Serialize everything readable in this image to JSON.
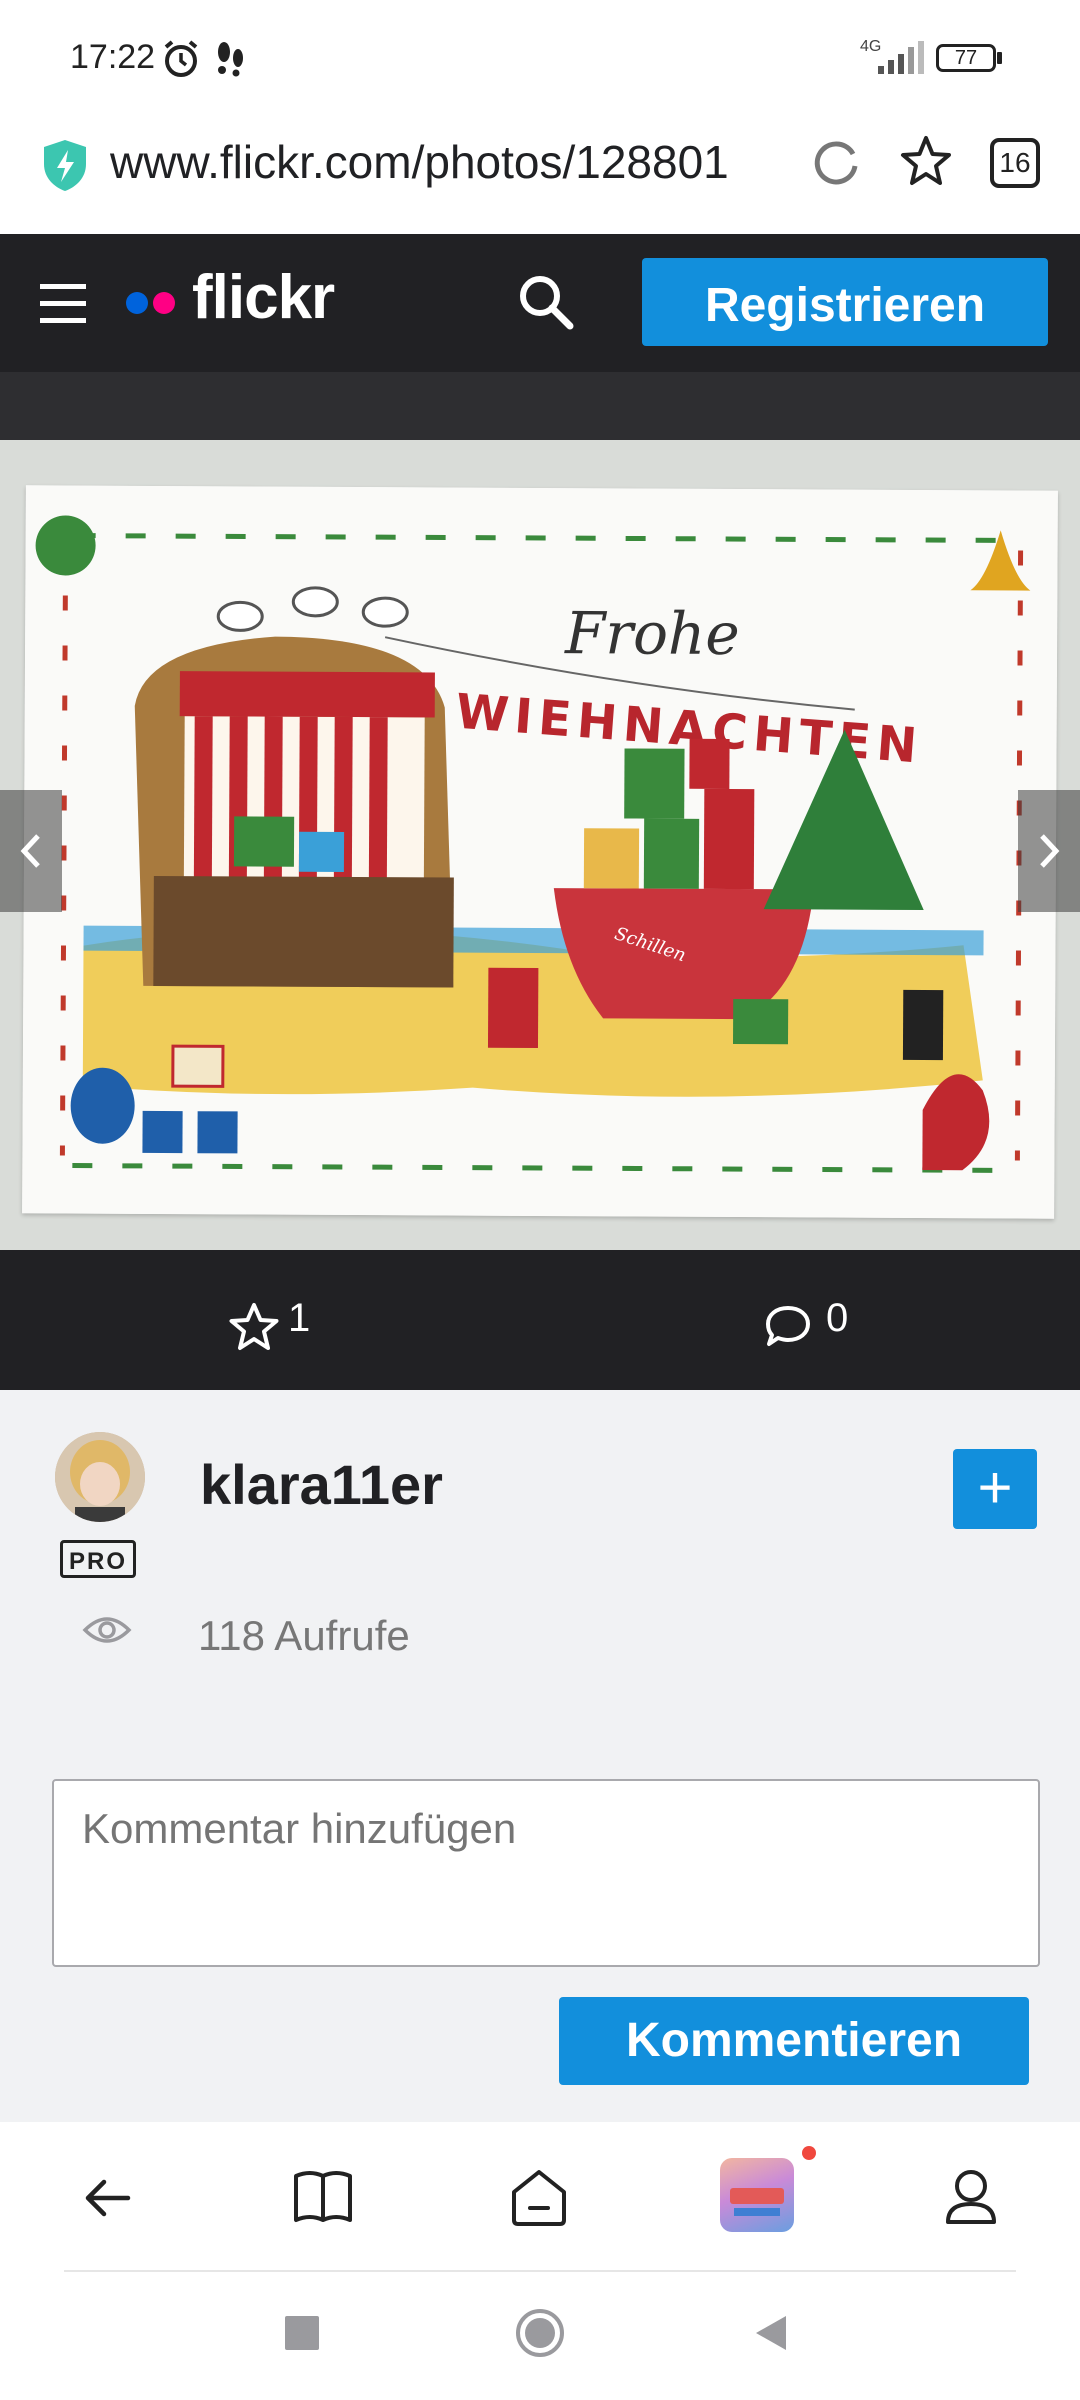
{
  "status_bar": {
    "time": "17:22",
    "network": "4G",
    "battery": "77",
    "icons": [
      "alarm-icon",
      "notification-icon",
      "signal-icon",
      "battery-icon"
    ]
  },
  "browser": {
    "url": "www.flickr.com/photos/128801",
    "tab_count": "16",
    "icons": [
      "secure-shield-icon",
      "reload-icon",
      "bookmark-star-icon"
    ]
  },
  "header": {
    "logo": "flickr",
    "register_label": "Registrieren",
    "icons": [
      "menu-icon",
      "search-icon"
    ]
  },
  "photo": {
    "card_title": "Frohe",
    "card_subtitle": "WIEHNACHTEN",
    "boat_name": "Schillen"
  },
  "actions": {
    "favorites": "1",
    "comments": "0"
  },
  "owner": {
    "username": "klara11er",
    "badge": "PRO",
    "follow_label": "+",
    "views": "118 Aufrufe"
  },
  "comment": {
    "placeholder": "Kommentar hinzufügen",
    "submit_label": "Kommentieren"
  },
  "bottom_nav": {
    "items": [
      "back-icon",
      "bookmarks-icon",
      "home-icon",
      "tabs-thumbnail",
      "profile-icon"
    ]
  },
  "colors": {
    "accent": "#128fdc",
    "header_bg": "#212124",
    "flickr_blue": "#0063dc",
    "flickr_pink": "#ff0084"
  }
}
